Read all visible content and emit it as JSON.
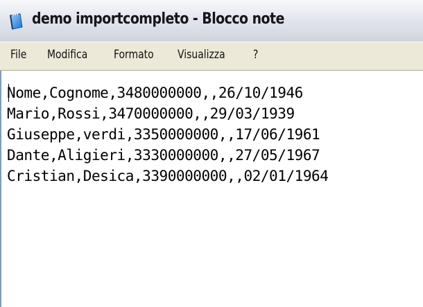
{
  "window": {
    "title": "demo importcompleto - Blocco note",
    "icon": "notepad-icon"
  },
  "menu": {
    "items": [
      {
        "label": "File"
      },
      {
        "label": "Modifica"
      },
      {
        "label": "Formato"
      },
      {
        "label": "Visualizza"
      },
      {
        "label": "?"
      }
    ]
  },
  "editor": {
    "lines": [
      "Nome,Cognome,3480000000,,26/10/1946",
      "Mario,Rossi,3470000000,,29/03/1939",
      "Giuseppe,verdi,3350000000,,17/06/1961",
      "Dante,Aligieri,3330000000,,27/05/1967",
      "Cristian,Desica,3390000000,,02/01/1964"
    ]
  },
  "colors": {
    "menubar": "#ece9d8",
    "titlebar_top": "#f7f8fb",
    "titlebar_bottom": "#cfd4de",
    "editor_bg": "#ffffff",
    "icon_blue": "#2f7fd6"
  }
}
